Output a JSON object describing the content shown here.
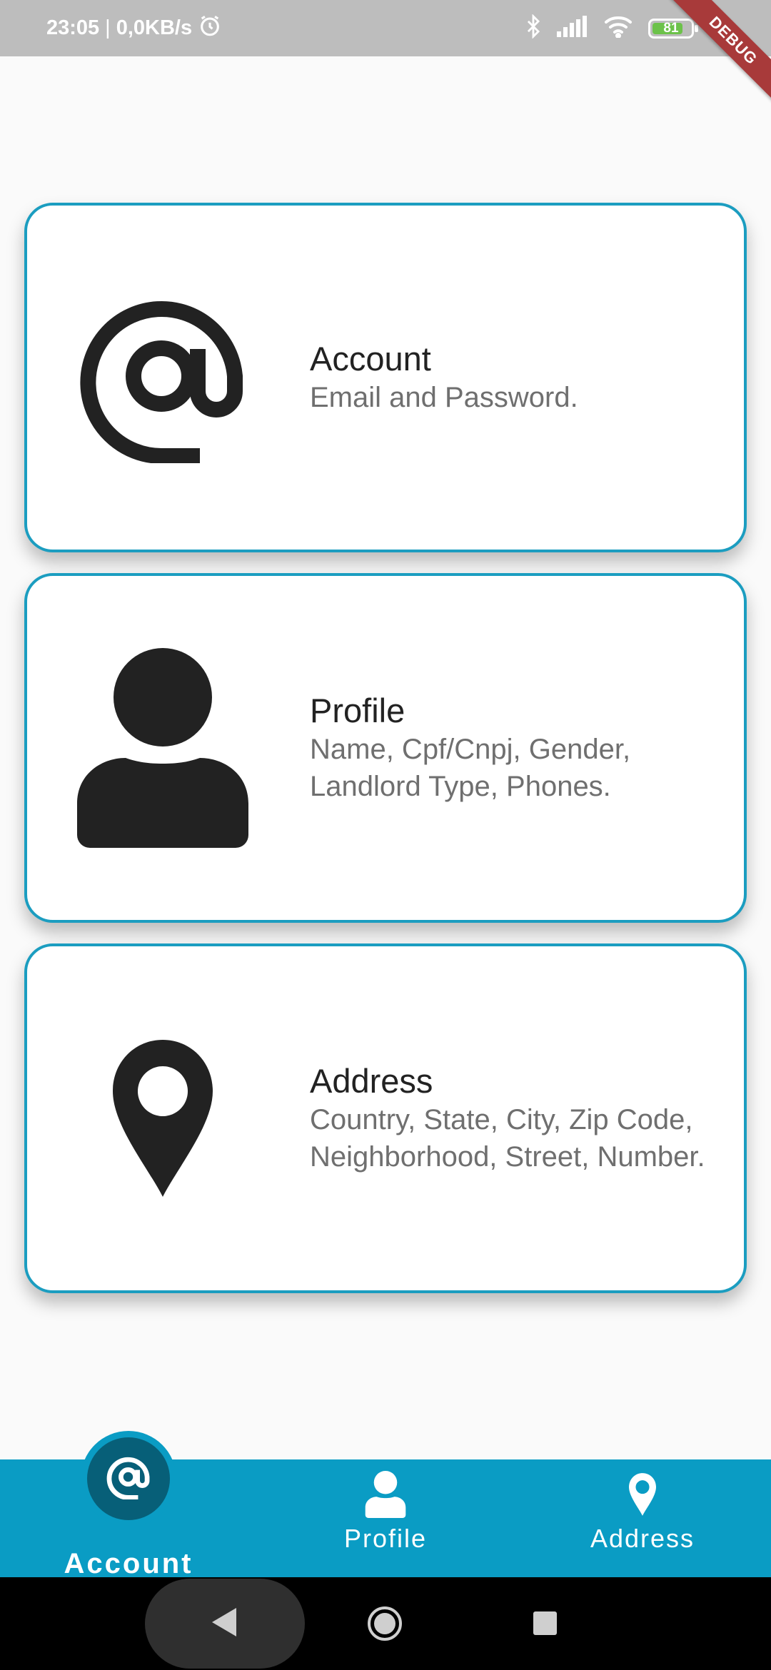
{
  "status_bar": {
    "time": "23:05",
    "separator": "|",
    "speed": "0,0KB/s",
    "battery": "81",
    "icons": [
      "alarm-icon",
      "bluetooth-icon",
      "signal-icon",
      "wifi-icon",
      "battery-icon",
      "charging-icon"
    ]
  },
  "debug_banner": "DEBUG",
  "cards": [
    {
      "icon": "at-sign-icon",
      "title": "Account",
      "subtitle": "Email and Password."
    },
    {
      "icon": "person-icon",
      "title": "Profile",
      "subtitle": "Name, Cpf/Cnpj, Gender, Landlord Type, Phones."
    },
    {
      "icon": "location-pin-icon",
      "title": "Address",
      "subtitle": "Country, State, City, Zip Code, Neighborhood, Street, Number."
    }
  ],
  "bottom_nav": {
    "active_index": 0,
    "items": [
      {
        "label": "Account",
        "icon": "at-sign-icon"
      },
      {
        "label": "Profile",
        "icon": "person-icon"
      },
      {
        "label": "Address",
        "icon": "location-pin-icon"
      }
    ]
  },
  "colors": {
    "accent": "#0a9cc4",
    "card_border": "#1b9dc0",
    "active_bubble": "#075f78",
    "status_bar": "#bdbdbd",
    "debug_ribbon": "#a83a3a"
  }
}
